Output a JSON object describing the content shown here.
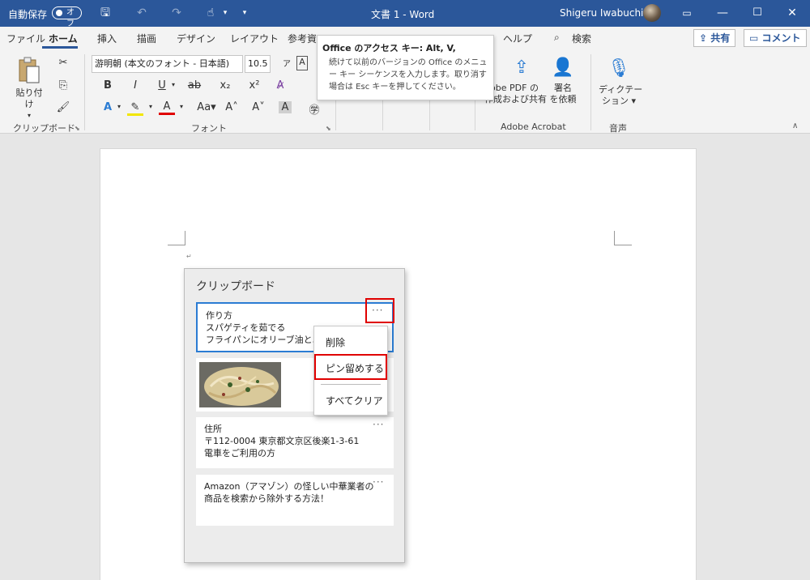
{
  "titlebar": {
    "autosave": "自動保存",
    "toggle": "オフ",
    "doc_title": "文書 1  -  Word",
    "user": "Shigeru Iwabuchi"
  },
  "tabs": {
    "items": [
      "ファイル",
      "ホーム",
      "挿入",
      "描画",
      "デザイン",
      "レイアウト",
      "参考資",
      "ヘルプ"
    ],
    "search": "検索",
    "share": "共有",
    "comment": "コメント"
  },
  "ribbon": {
    "paste": "貼り付け",
    "clipboard_group": "クリップボード",
    "font_name": "游明朝 (本文のフォント - 日本語)",
    "font_size": "10.5",
    "font_group": "フォント",
    "acrobat_btn1a": "obe PDF の",
    "acrobat_btn1b": "作成および共有",
    "acrobat_btn2a": "署名",
    "acrobat_btn2b": "を依頼",
    "acrobat_group": "Adobe Acrobat",
    "dictation_a": "ディクテー",
    "dictation_b": "ション",
    "voice_group": "音声"
  },
  "tooltip": {
    "title": "Office のアクセス キー: Alt, V,",
    "body": "続けて以前のバージョンの Office のメニュー キー シーケンスを入力します。取り消す場合は Esc キーを押してください。"
  },
  "clipboard": {
    "title": "クリップボード",
    "card1": [
      "作り方",
      "スパゲティを茹でる",
      "フライパンにオリーブ油とニンニク"
    ],
    "card3": [
      "住所",
      "〒112-0004 東京都文京区後楽1-3-61",
      "電車をご利用の方"
    ],
    "card4": [
      "Amazon（アマゾン）の怪しい中華業者の",
      "商品を検索から除外する方法！"
    ],
    "more": "···"
  },
  "context_menu": {
    "delete": "削除",
    "pin": "ピン留めする",
    "clear_all": "すべてクリア"
  },
  "colors": {
    "titlebar": "#2b579a",
    "highlight_red": "#e00000",
    "selection_blue": "#2b7cd3"
  }
}
